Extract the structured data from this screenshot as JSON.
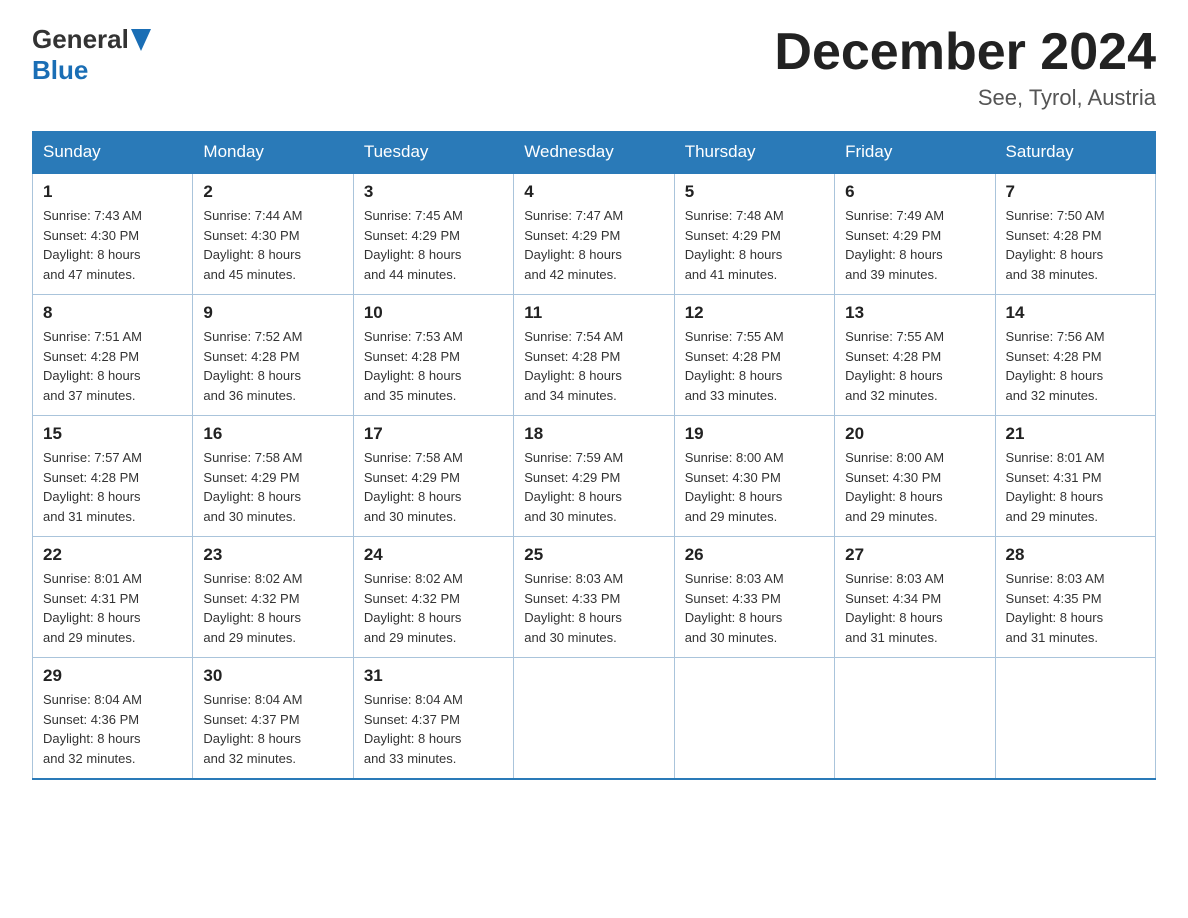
{
  "header": {
    "logo_text_general": "General",
    "logo_text_blue": "Blue",
    "month_title": "December 2024",
    "location": "See, Tyrol, Austria"
  },
  "days_of_week": [
    "Sunday",
    "Monday",
    "Tuesday",
    "Wednesday",
    "Thursday",
    "Friday",
    "Saturday"
  ],
  "weeks": [
    [
      {
        "day": "1",
        "sunrise": "7:43 AM",
        "sunset": "4:30 PM",
        "daylight": "8 hours and 47 minutes."
      },
      {
        "day": "2",
        "sunrise": "7:44 AM",
        "sunset": "4:30 PM",
        "daylight": "8 hours and 45 minutes."
      },
      {
        "day": "3",
        "sunrise": "7:45 AM",
        "sunset": "4:29 PM",
        "daylight": "8 hours and 44 minutes."
      },
      {
        "day": "4",
        "sunrise": "7:47 AM",
        "sunset": "4:29 PM",
        "daylight": "8 hours and 42 minutes."
      },
      {
        "day": "5",
        "sunrise": "7:48 AM",
        "sunset": "4:29 PM",
        "daylight": "8 hours and 41 minutes."
      },
      {
        "day": "6",
        "sunrise": "7:49 AM",
        "sunset": "4:29 PM",
        "daylight": "8 hours and 39 minutes."
      },
      {
        "day": "7",
        "sunrise": "7:50 AM",
        "sunset": "4:28 PM",
        "daylight": "8 hours and 38 minutes."
      }
    ],
    [
      {
        "day": "8",
        "sunrise": "7:51 AM",
        "sunset": "4:28 PM",
        "daylight": "8 hours and 37 minutes."
      },
      {
        "day": "9",
        "sunrise": "7:52 AM",
        "sunset": "4:28 PM",
        "daylight": "8 hours and 36 minutes."
      },
      {
        "day": "10",
        "sunrise": "7:53 AM",
        "sunset": "4:28 PM",
        "daylight": "8 hours and 35 minutes."
      },
      {
        "day": "11",
        "sunrise": "7:54 AM",
        "sunset": "4:28 PM",
        "daylight": "8 hours and 34 minutes."
      },
      {
        "day": "12",
        "sunrise": "7:55 AM",
        "sunset": "4:28 PM",
        "daylight": "8 hours and 33 minutes."
      },
      {
        "day": "13",
        "sunrise": "7:55 AM",
        "sunset": "4:28 PM",
        "daylight": "8 hours and 32 minutes."
      },
      {
        "day": "14",
        "sunrise": "7:56 AM",
        "sunset": "4:28 PM",
        "daylight": "8 hours and 32 minutes."
      }
    ],
    [
      {
        "day": "15",
        "sunrise": "7:57 AM",
        "sunset": "4:28 PM",
        "daylight": "8 hours and 31 minutes."
      },
      {
        "day": "16",
        "sunrise": "7:58 AM",
        "sunset": "4:29 PM",
        "daylight": "8 hours and 30 minutes."
      },
      {
        "day": "17",
        "sunrise": "7:58 AM",
        "sunset": "4:29 PM",
        "daylight": "8 hours and 30 minutes."
      },
      {
        "day": "18",
        "sunrise": "7:59 AM",
        "sunset": "4:29 PM",
        "daylight": "8 hours and 30 minutes."
      },
      {
        "day": "19",
        "sunrise": "8:00 AM",
        "sunset": "4:30 PM",
        "daylight": "8 hours and 29 minutes."
      },
      {
        "day": "20",
        "sunrise": "8:00 AM",
        "sunset": "4:30 PM",
        "daylight": "8 hours and 29 minutes."
      },
      {
        "day": "21",
        "sunrise": "8:01 AM",
        "sunset": "4:31 PM",
        "daylight": "8 hours and 29 minutes."
      }
    ],
    [
      {
        "day": "22",
        "sunrise": "8:01 AM",
        "sunset": "4:31 PM",
        "daylight": "8 hours and 29 minutes."
      },
      {
        "day": "23",
        "sunrise": "8:02 AM",
        "sunset": "4:32 PM",
        "daylight": "8 hours and 29 minutes."
      },
      {
        "day": "24",
        "sunrise": "8:02 AM",
        "sunset": "4:32 PM",
        "daylight": "8 hours and 29 minutes."
      },
      {
        "day": "25",
        "sunrise": "8:03 AM",
        "sunset": "4:33 PM",
        "daylight": "8 hours and 30 minutes."
      },
      {
        "day": "26",
        "sunrise": "8:03 AM",
        "sunset": "4:33 PM",
        "daylight": "8 hours and 30 minutes."
      },
      {
        "day": "27",
        "sunrise": "8:03 AM",
        "sunset": "4:34 PM",
        "daylight": "8 hours and 31 minutes."
      },
      {
        "day": "28",
        "sunrise": "8:03 AM",
        "sunset": "4:35 PM",
        "daylight": "8 hours and 31 minutes."
      }
    ],
    [
      {
        "day": "29",
        "sunrise": "8:04 AM",
        "sunset": "4:36 PM",
        "daylight": "8 hours and 32 minutes."
      },
      {
        "day": "30",
        "sunrise": "8:04 AM",
        "sunset": "4:37 PM",
        "daylight": "8 hours and 32 minutes."
      },
      {
        "day": "31",
        "sunrise": "8:04 AM",
        "sunset": "4:37 PM",
        "daylight": "8 hours and 33 minutes."
      },
      null,
      null,
      null,
      null
    ]
  ],
  "labels": {
    "sunrise": "Sunrise:",
    "sunset": "Sunset:",
    "daylight": "Daylight:"
  }
}
